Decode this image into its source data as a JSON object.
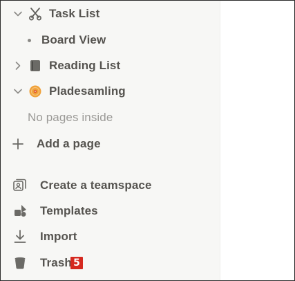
{
  "sidebar": {
    "items": [
      {
        "label": "Task List",
        "icon": "scissors-icon",
        "chevron": "down"
      },
      {
        "label": "Board View",
        "icon": "bullet-icon"
      },
      {
        "label": "Reading List",
        "icon": "book-icon",
        "chevron": "right"
      },
      {
        "label": "Pladesamling",
        "icon": "vinyl-record-icon",
        "chevron": "down"
      },
      {
        "label": "No pages inside"
      },
      {
        "label": "Add a page",
        "icon": "plus-icon"
      },
      {
        "label": "Create a teamspace",
        "icon": "teamspace-icon"
      },
      {
        "label": "Templates",
        "icon": "templates-icon"
      },
      {
        "label": "Import",
        "icon": "import-icon"
      },
      {
        "label": "Trash",
        "icon": "trash-icon",
        "badge": "5"
      }
    ]
  },
  "colors": {
    "sidebar_bg": "#f7f7f5",
    "text": "#55534f",
    "muted": "#9b9a97",
    "badge": "#d5291f",
    "record_orange": "#f0a23a"
  }
}
